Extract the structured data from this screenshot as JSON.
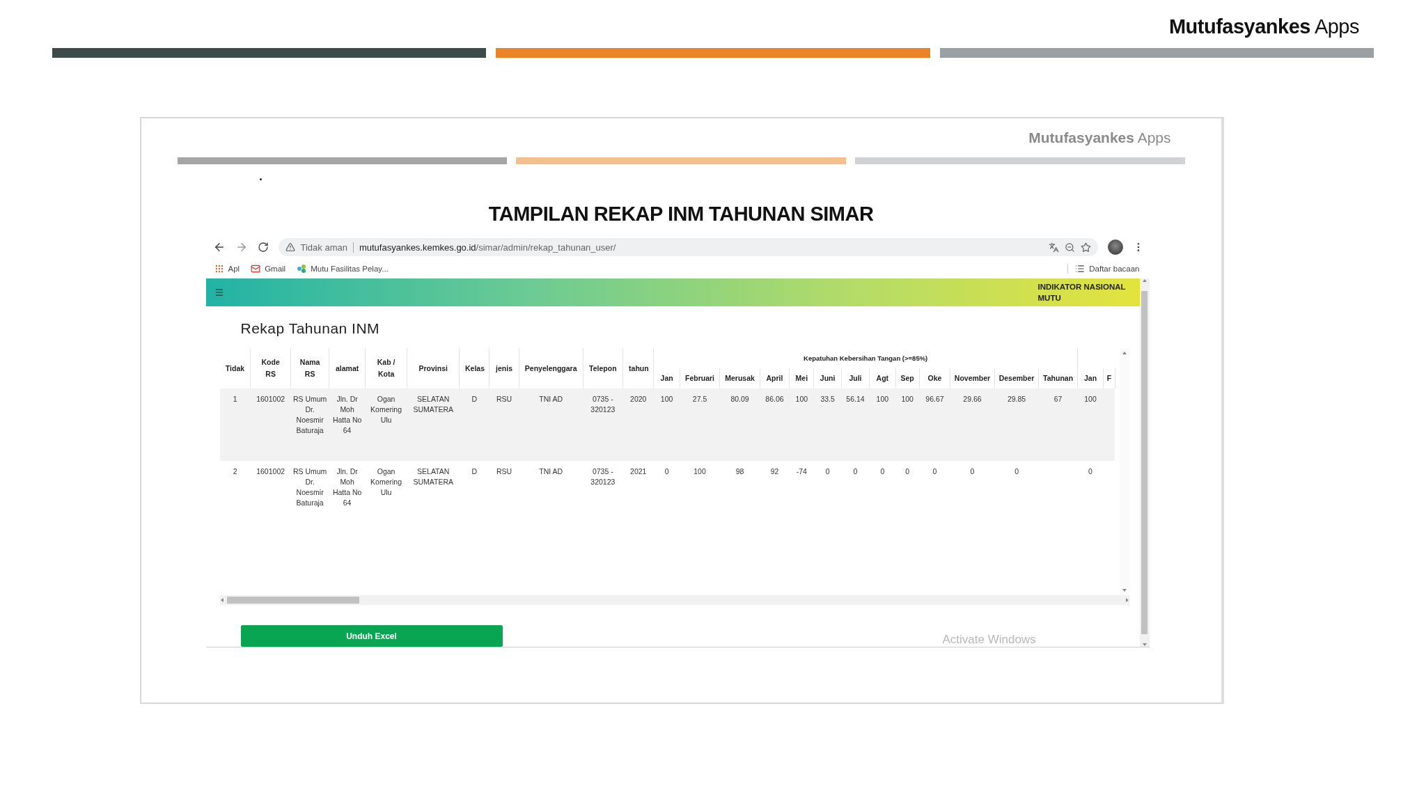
{
  "slide": {
    "brand": "**Mutufasyankes** Apps",
    "bars": [
      {
        "color": "#3d4b4a"
      },
      {
        "color": "#ea8426"
      },
      {
        "color": "#9aa0a3"
      }
    ]
  },
  "frame": {
    "brand": "**Mutufasyankes** Apps",
    "bars": [
      {
        "color": "#a6a6a6"
      },
      {
        "color": "#f5c08f"
      },
      {
        "color": "#d0d2d3"
      }
    ],
    "heading": "TAMPILAN REKAP INM TAHUNAN SIMAR"
  },
  "browser": {
    "security": "Tidak aman",
    "url_host": "mutufasyankes.kemkes.go.id",
    "url_path": "/simar/admin/rekap_tahunan_user/",
    "bookmarks": [
      {
        "kind": "apps",
        "label": "Apl"
      },
      {
        "kind": "mail",
        "label": "Gmail"
      },
      {
        "kind": "site",
        "label": "Mutu Fasilitas Pelay..."
      }
    ],
    "reading_list": "Daftar bacaan"
  },
  "app": {
    "header_title": "INDIKATOR NASIONAL MUTU",
    "page_title": "Rekap Tahunan INM",
    "table": {
      "columns": [
        "Tidak",
        "Kode RS",
        "Nama RS",
        "alamat",
        "Kab / Kota",
        "Provinsi",
        "Kelas",
        "jenis",
        "Penyelenggara",
        "Telepon",
        "tahun"
      ],
      "group_header": "Kepatuhan Kebersihan Tangan (>=85%)",
      "month_columns": [
        "Jan",
        "Februari",
        "Merusak",
        "April",
        "Mei",
        "Juni",
        "Juli",
        "Agt",
        "Sep",
        "Oke",
        "November",
        "Desember",
        "Tahunan",
        "Jan",
        "F"
      ],
      "rows": [
        {
          "cells": [
            "1",
            "1601002",
            "RS Umum Dr. Noesmir Baturaja",
            "Jln. Dr Moh Hatta No 64",
            "Ogan Komering Ulu",
            "SELATAN SUMATERA",
            "D",
            "RSU",
            "TNI AD",
            "0735 - 320123",
            "2020",
            "100",
            "27.5",
            "80.09",
            "86.06",
            "100",
            "33.5",
            "56.14",
            "100",
            "100",
            "96.67",
            "29.66",
            "29.85",
            "67",
            "100",
            null
          ]
        },
        {
          "cells": [
            "2",
            "1601002",
            "RS Umum Dr. Noesmir Baturaja",
            "Jln. Dr Moh Hatta No 64",
            "Ogan Komering Ulu",
            "SELATAN SUMATERA",
            "D",
            "RSU",
            "TNI AD",
            "0735 - 320123",
            "2021",
            "0",
            "100",
            "98",
            "92",
            "-74",
            "0",
            "0",
            "0",
            "0",
            "0",
            "0",
            "0",
            null,
            "0",
            null
          ]
        }
      ]
    },
    "download_button": "Unduh Excel"
  },
  "os_watermark": "Activate Windows"
}
